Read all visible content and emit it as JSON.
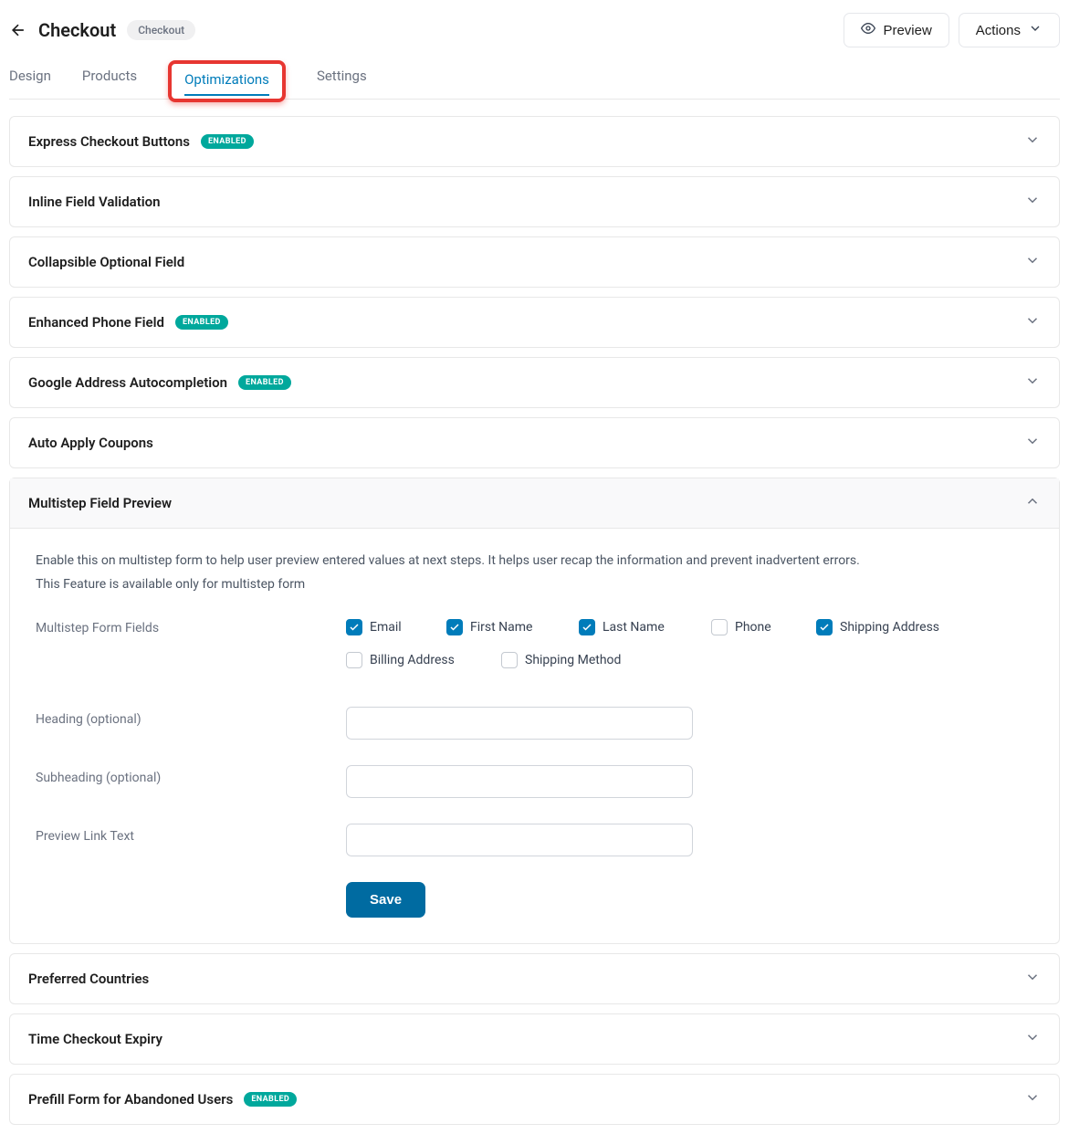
{
  "header": {
    "title": "Checkout",
    "pill": "Checkout",
    "preview_label": "Preview",
    "actions_label": "Actions"
  },
  "tabs": [
    {
      "id": "design",
      "label": "Design",
      "active": false,
      "hl": false
    },
    {
      "id": "products",
      "label": "Products",
      "active": false,
      "hl": false
    },
    {
      "id": "optimizations",
      "label": "Optimizations",
      "active": true,
      "hl": true
    },
    {
      "id": "settings",
      "label": "Settings",
      "active": false,
      "hl": false
    }
  ],
  "panels": [
    {
      "id": "express-checkout",
      "title": "Express Checkout Buttons",
      "enabled": true,
      "open": false
    },
    {
      "id": "inline-validation",
      "title": "Inline Field Validation",
      "enabled": false,
      "open": false
    },
    {
      "id": "collapsible-optional",
      "title": "Collapsible Optional Field",
      "enabled": false,
      "open": false
    },
    {
      "id": "enhanced-phone",
      "title": "Enhanced Phone Field",
      "enabled": true,
      "open": false
    },
    {
      "id": "google-address",
      "title": "Google Address Autocompletion",
      "enabled": true,
      "open": false
    },
    {
      "id": "auto-coupons",
      "title": "Auto Apply Coupons",
      "enabled": false,
      "open": false
    },
    {
      "id": "multistep-preview",
      "title": "Multistep Field Preview",
      "enabled": false,
      "open": true
    },
    {
      "id": "preferred-countries",
      "title": "Preferred Countries",
      "enabled": false,
      "open": false
    },
    {
      "id": "time-expiry",
      "title": "Time Checkout Expiry",
      "enabled": false,
      "open": false
    },
    {
      "id": "prefill-abandoned",
      "title": "Prefill Form for Abandoned Users",
      "enabled": true,
      "open": false
    }
  ],
  "enabled_badge": "ENABLED",
  "multistep": {
    "desc_line1": "Enable this on multistep form to help user preview entered values at next steps. It helps user recap the information and prevent inadvertent errors.",
    "desc_line2": "This Feature is available only for multistep form",
    "fields_label": "Multistep Form Fields",
    "heading_label": "Heading (optional)",
    "subheading_label": "Subheading (optional)",
    "preview_link_label": "Preview Link Text",
    "save_label": "Save",
    "checks": [
      {
        "id": "email",
        "label": "Email",
        "checked": true,
        "cls": "c1"
      },
      {
        "id": "first-name",
        "label": "First Name",
        "checked": true,
        "cls": "c2"
      },
      {
        "id": "last-name",
        "label": "Last Name",
        "checked": true,
        "cls": "c3"
      },
      {
        "id": "phone",
        "label": "Phone",
        "checked": false,
        "cls": "c4"
      },
      {
        "id": "shipping-address",
        "label": "Shipping Address",
        "checked": true,
        "cls": "c5"
      },
      {
        "id": "billing-address",
        "label": "Billing Address",
        "checked": false,
        "cls": "ca"
      },
      {
        "id": "shipping-method",
        "label": "Shipping Method",
        "checked": false,
        "cls": "cb"
      }
    ],
    "heading_value": "",
    "subheading_value": "",
    "preview_link_value": ""
  }
}
